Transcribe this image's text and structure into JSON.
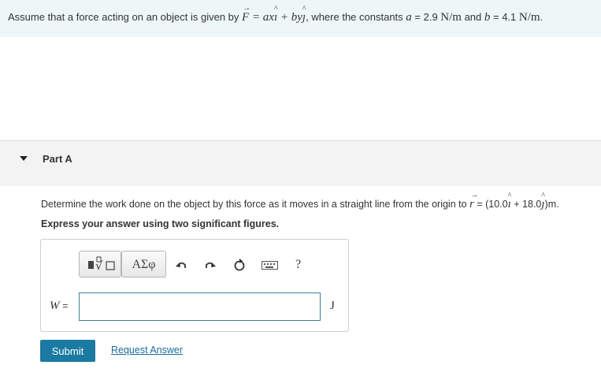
{
  "intro": {
    "text_1": "Assume that a force acting on an object is given by ",
    "force_symbol": "F",
    "force_expr": " = ax",
    "plus": " + by",
    "text_2": ", where the constants ",
    "a_sym": "a",
    "a_val": " = 2.9 ",
    "unit_a": "N/m",
    "text_3": " and ",
    "b_sym": "b",
    "b_val": " = 4.1 ",
    "unit_b": "N/m",
    "text_4": "."
  },
  "part": {
    "title": "Part A"
  },
  "question": {
    "text_1": "Determine the work done on the object by this force as it moves in a straight line from the origin to ",
    "r_sym": "r",
    "text_2": " = (10.0",
    "text_3": " + 18.0",
    "text_4": ")m."
  },
  "instructions": "Express your answer using two significant figures.",
  "toolbar": {
    "templates_icon": "templates-icon",
    "symbols_label": "ΑΣφ",
    "undo_icon": "undo-icon",
    "redo_icon": "redo-icon",
    "reset_icon": "reset-icon",
    "keyboard_icon": "keyboard-icon",
    "help_label": "?"
  },
  "answer": {
    "variable": "W",
    "equals": "=",
    "value": "",
    "unit": "J"
  },
  "buttons": {
    "submit": "Submit",
    "request_answer": "Request Answer"
  },
  "colors": {
    "intro_bg": "#eef7f8",
    "accent": "#1a7aa1",
    "link": "#1a6c9a"
  }
}
